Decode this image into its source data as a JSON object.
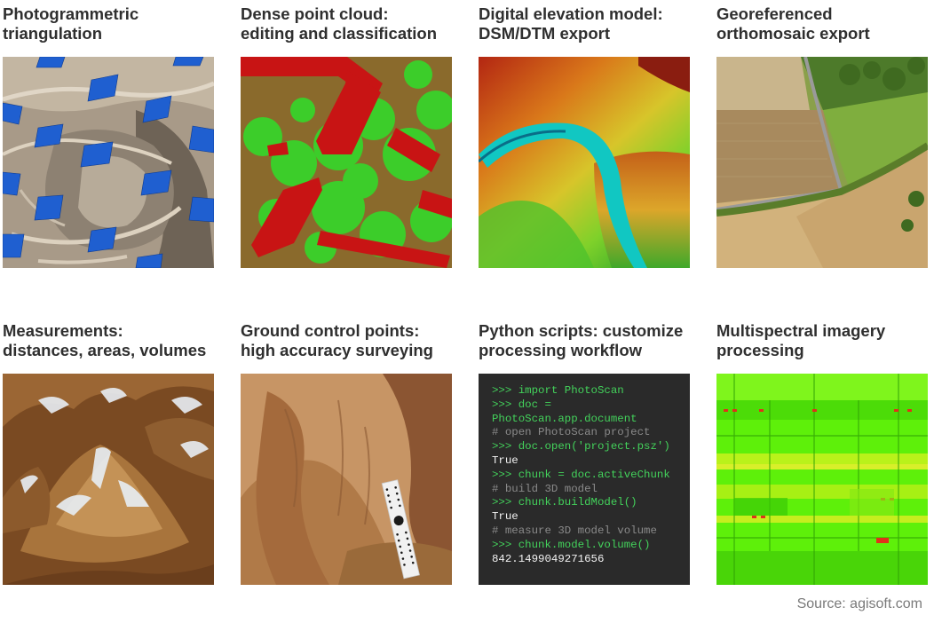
{
  "tiles": [
    {
      "lines": [
        "Photogrammetric",
        "triangulation"
      ]
    },
    {
      "lines": [
        "Dense point cloud:",
        "editing and classification"
      ]
    },
    {
      "lines": [
        "Digital elevation model:",
        "DSM/DTM export"
      ]
    },
    {
      "lines": [
        "Georeferenced",
        "orthomosaic export"
      ]
    },
    {
      "lines": [
        "Measurements:",
        "distances, areas, volumes"
      ]
    },
    {
      "lines": [
        "Ground control points:",
        "high accuracy surveying"
      ]
    },
    {
      "lines": [
        "Python scripts: customize",
        "processing workflow"
      ]
    },
    {
      "lines": [
        "Multispectral imagery",
        "processing"
      ]
    }
  ],
  "code": {
    "lines": [
      {
        "text": ">>> import PhotoScan",
        "kind": "code"
      },
      {
        "text": ">>> doc =",
        "kind": "code"
      },
      {
        "text": "PhotoScan.app.document",
        "kind": "code"
      },
      {
        "text": "# open PhotoScan project",
        "kind": "comment"
      },
      {
        "text": ">>> doc.open('project.psz')",
        "kind": "code"
      },
      {
        "text": "True",
        "kind": "out"
      },
      {
        "text": ">>> chunk = doc.activeChunk",
        "kind": "code"
      },
      {
        "text": "# build 3D model",
        "kind": "comment"
      },
      {
        "text": ">>> chunk.buildModel()",
        "kind": "code"
      },
      {
        "text": "True",
        "kind": "out"
      },
      {
        "text": "# measure 3D model volume",
        "kind": "comment"
      },
      {
        "text": ">>> chunk.model.volume()",
        "kind": "code"
      },
      {
        "text": "842.1499049271656",
        "kind": "out"
      }
    ]
  },
  "source": "Source: agisoft.com",
  "colors": {
    "title_text": "#2f2f2f",
    "code_background": "#2a2a2a",
    "code_green": "#43d25b",
    "code_comment": "#8a8a8a",
    "code_output": "#f2f2f2",
    "camera_blue": "#1f5fd0",
    "classified_building_red": "#c81414",
    "classified_vegetation_green": "#3ccd2a",
    "multispectral_green": "#5ef00a"
  }
}
